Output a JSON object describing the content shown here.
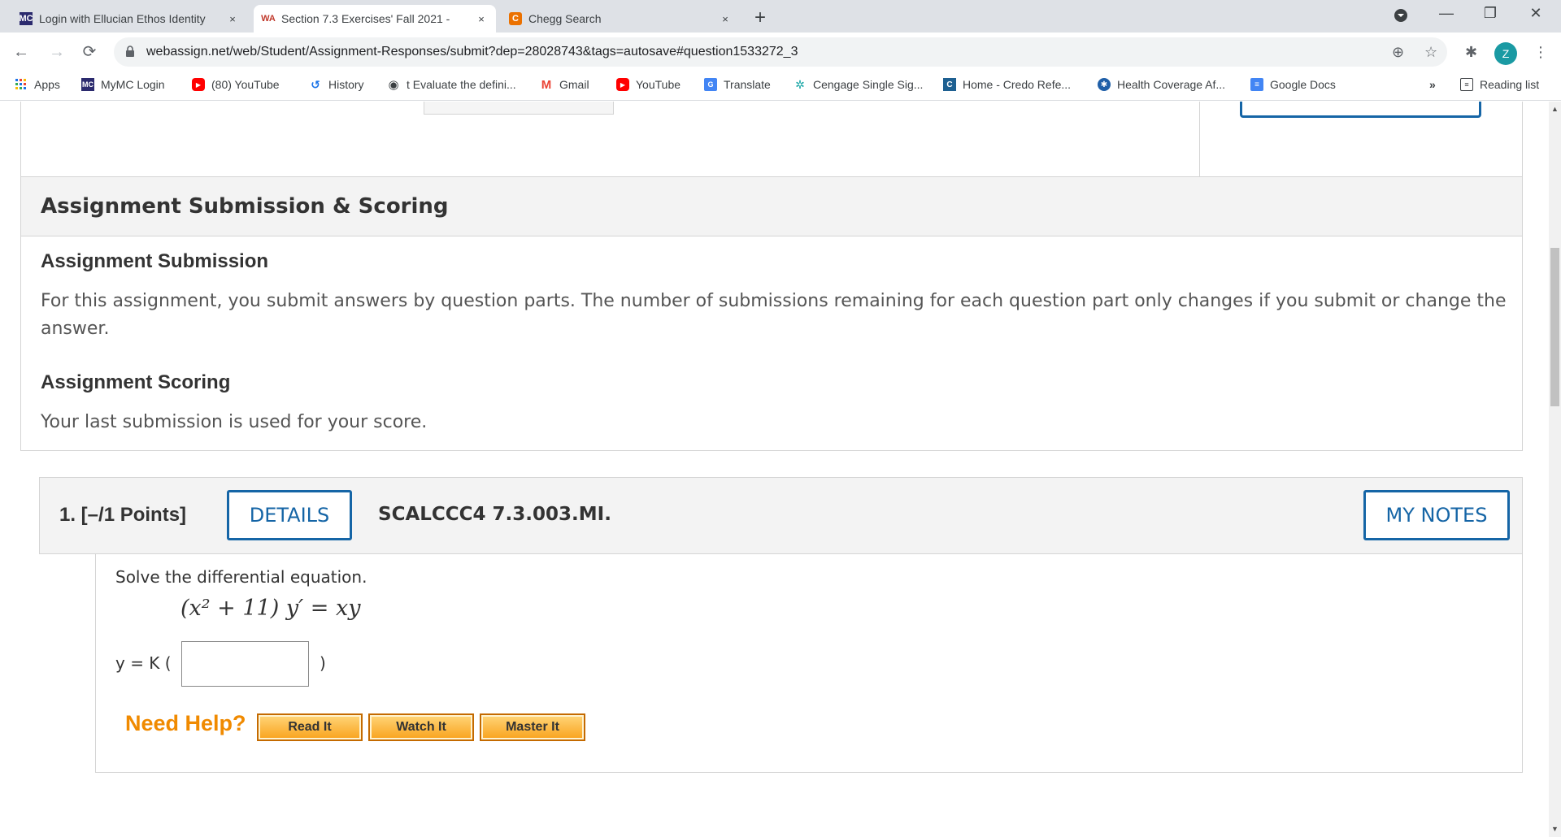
{
  "browser": {
    "tabs": [
      {
        "favicon": "MC",
        "title": "Login with Ellucian Ethos Identity",
        "close": "×"
      },
      {
        "favicon": "WA",
        "title": "Section 7.3 Exercises' Fall 2021 - ",
        "close": "×"
      },
      {
        "favicon": "C",
        "title": "Chegg Search",
        "close": "×"
      }
    ],
    "new_tab": "+",
    "window_controls": {
      "minimize": "—",
      "restore": "❐",
      "close": "✕"
    },
    "url": "webassign.net/web/Student/Assignment-Responses/submit?dep=28028743&tags=autosave#question1533272_3",
    "profile_initial": "Z",
    "bookmarks": [
      {
        "icon": "apps-icon",
        "label": "Apps"
      },
      {
        "icon": "mc-icon",
        "label": "MyMC Login"
      },
      {
        "icon": "youtube-icon",
        "label": "(80) YouTube"
      },
      {
        "icon": "history-icon",
        "label": "History"
      },
      {
        "icon": "globe-icon",
        "label": "t Evaluate the defini..."
      },
      {
        "icon": "gmail-icon",
        "label": "Gmail"
      },
      {
        "icon": "youtube-icon",
        "label": "YouTube"
      },
      {
        "icon": "translate-icon",
        "label": "Translate"
      },
      {
        "icon": "cengage-icon",
        "label": "Cengage Single Sig..."
      },
      {
        "icon": "credo-icon",
        "label": "Home - Credo Refe..."
      },
      {
        "icon": "health-icon",
        "label": "Health Coverage Af..."
      },
      {
        "icon": "docs-icon",
        "label": "Google Docs"
      }
    ],
    "bookmarks_overflow": "»",
    "reading_list": "Reading list"
  },
  "scoring": {
    "title": "Assignment Submission & Scoring",
    "submission_heading": "Assignment Submission",
    "submission_text_line1": "For this assignment, you submit answers by question parts. The number of submissions remaining for each question part only changes if you submit or change the",
    "submission_text_line2": "answer.",
    "scoring_heading": "Assignment Scoring",
    "scoring_text": "Your last submission is used for your score."
  },
  "question": {
    "number_points": "1.  [–/1 Points]",
    "details_label": "DETAILS",
    "code": "SCALCCC4 7.3.003.MI.",
    "my_notes_label": "MY NOTES",
    "prompt": "Solve the differential equation.",
    "equation": "(x² + 11) y′ = xy",
    "answer_prefix": "y = K (",
    "answer_suffix": ")",
    "answer_value": "",
    "need_help": "Need Help?",
    "help_buttons": [
      "Read It",
      "Watch It",
      "Master It"
    ]
  }
}
